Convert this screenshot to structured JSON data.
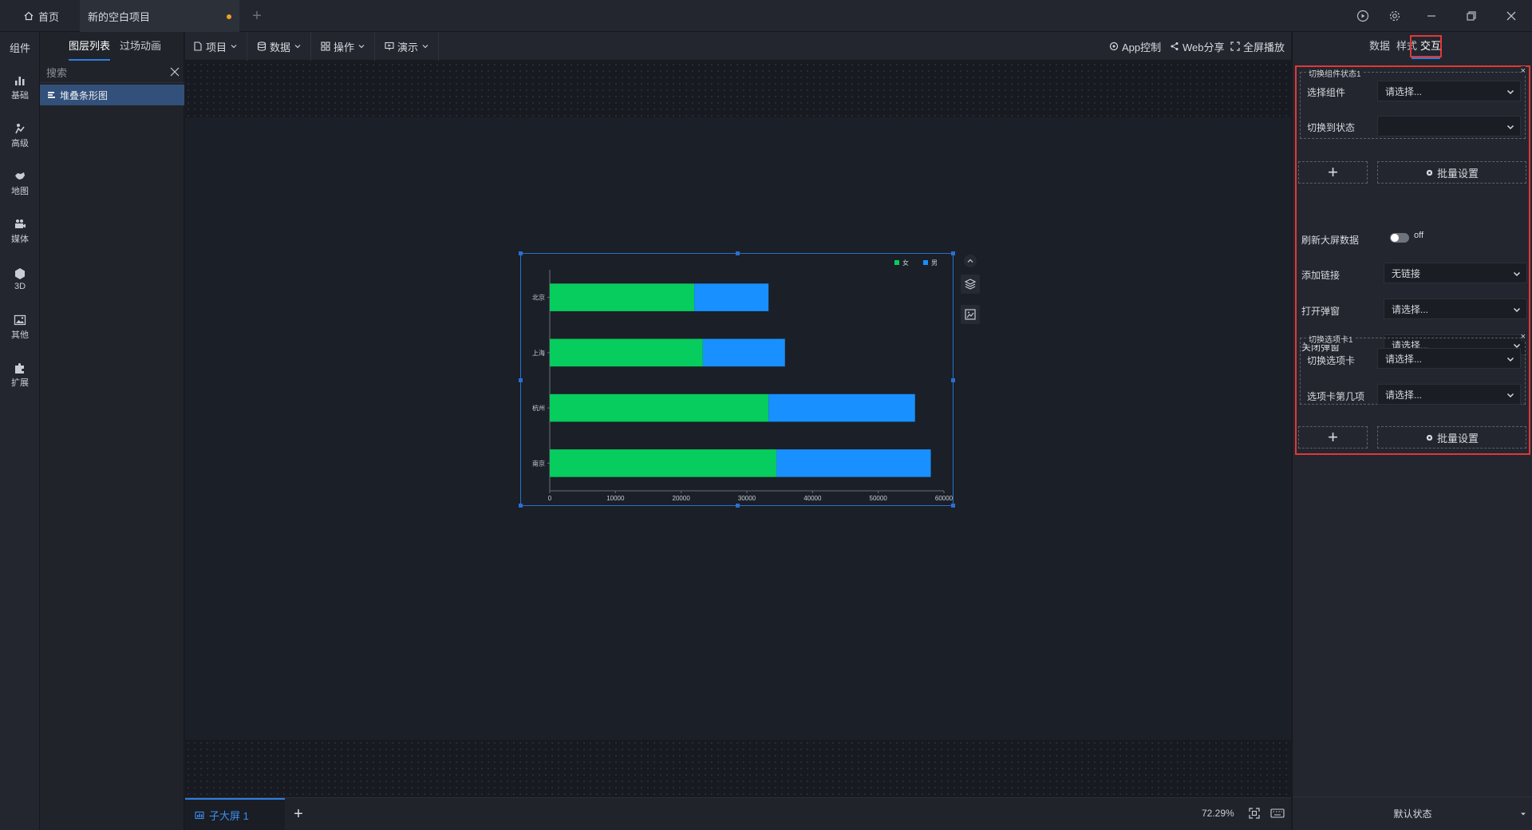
{
  "titlebar": {
    "home_label": "首页",
    "project_tab_label": "新的空白项目",
    "new_tab_symbol": "+"
  },
  "iconbar": {
    "title": "组件",
    "categories": [
      {
        "label": "基础",
        "icon": "bar-chart-icon"
      },
      {
        "label": "高级",
        "icon": "advanced-icon"
      },
      {
        "label": "地图",
        "icon": "map-icon"
      },
      {
        "label": "媒体",
        "icon": "video-camera-icon"
      },
      {
        "label": "3D",
        "icon": "cube-icon"
      },
      {
        "label": "其他",
        "icon": "image-icon"
      },
      {
        "label": "扩展",
        "icon": "puzzle-icon"
      }
    ]
  },
  "layerpanel": {
    "tab_layers": "图层列表",
    "tab_animation": "过场动画",
    "search_placeholder": "搜索",
    "items": [
      "堆叠条形图"
    ]
  },
  "toolbar": {
    "menus": [
      "项目",
      "数据",
      "操作",
      "演示"
    ],
    "app_control": "App控制",
    "web_share": "Web分享",
    "fullscreen": "全屏播放"
  },
  "chart_data": {
    "type": "bar",
    "orientation": "horizontal",
    "stacked": true,
    "categories": [
      "北京",
      "上海",
      "杭州",
      "南京"
    ],
    "series": [
      {
        "name": "女",
        "values": [
          22000,
          23300,
          33300,
          34500
        ],
        "color": "#07cc5e"
      },
      {
        "name": "男",
        "values": [
          11300,
          12500,
          22300,
          23500
        ],
        "color": "#1890ff"
      }
    ],
    "xlim": [
      0,
      60000
    ],
    "xticks": [
      0,
      10000,
      20000,
      30000,
      40000,
      50000,
      60000
    ],
    "legend_position": "top-right",
    "grid": false
  },
  "bottombar": {
    "screen_tab_label": "子大屏 1",
    "add_symbol": "+",
    "zoom": "72.29%"
  },
  "rightpanel": {
    "tabs": [
      "数据",
      "样式",
      "交互"
    ],
    "active_tab": "交互",
    "group1_title": "切换组件状态1",
    "select_component_label": "选择组件",
    "select_component_value": "请选择...",
    "switch_state_label": "切换到状态",
    "switch_state_value": "",
    "add_symbol": "+",
    "batch_label": "批量设置",
    "refresh_label": "刷新大屏数据",
    "refresh_state": "off",
    "link_label": "添加链接",
    "link_value": "无链接",
    "open_popup_label": "打开弹窗",
    "open_popup_value": "请选择...",
    "close_popup_label": "关闭弹窗",
    "close_popup_value": "请选择...",
    "group2_title": "切换选项卡1",
    "switch_tab_label": "切换选项卡",
    "switch_tab_value": "请选择...",
    "tab_index_label": "选项卡第几项",
    "tab_index_value": "请选择...",
    "batch_label_2": "批量设置",
    "default_state": "默认状态"
  }
}
